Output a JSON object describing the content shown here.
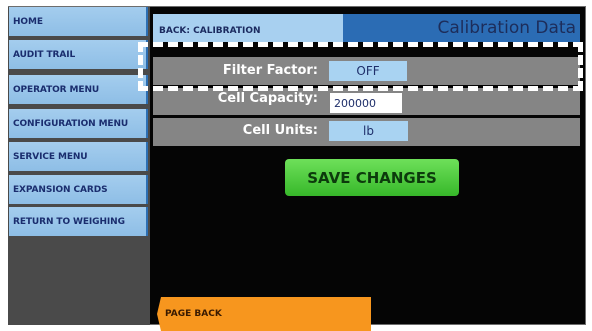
{
  "sidebar": {
    "items": [
      {
        "label": "HOME"
      },
      {
        "label": "AUDIT TRAIL"
      },
      {
        "label": "OPERATOR MENU"
      },
      {
        "label": "CONFIGURATION MENU"
      },
      {
        "label": "SERVICE MENU"
      },
      {
        "label": "EXPANSION CARDS"
      },
      {
        "label": "RETURN TO WEIGHING"
      }
    ]
  },
  "header": {
    "back_label": "BACK: CALIBRATION",
    "title": "Calibration Data"
  },
  "rows": {
    "filter_factor": {
      "label": "Filter Factor:",
      "value": "OFF"
    },
    "cell_capacity": {
      "label": "Cell Capacity:",
      "value": "200000"
    },
    "cell_units": {
      "label": "Cell Units:",
      "value": "lb"
    }
  },
  "actions": {
    "save_label": "SAVE CHANGES",
    "page_back_label": "PAGE BACK"
  },
  "colors": {
    "nav_bg": "#a4cdee",
    "header_blue": "#2b6cb4",
    "row_gray": "#858585",
    "save_green": "#37b82a",
    "page_back_orange": "#f7961e"
  }
}
